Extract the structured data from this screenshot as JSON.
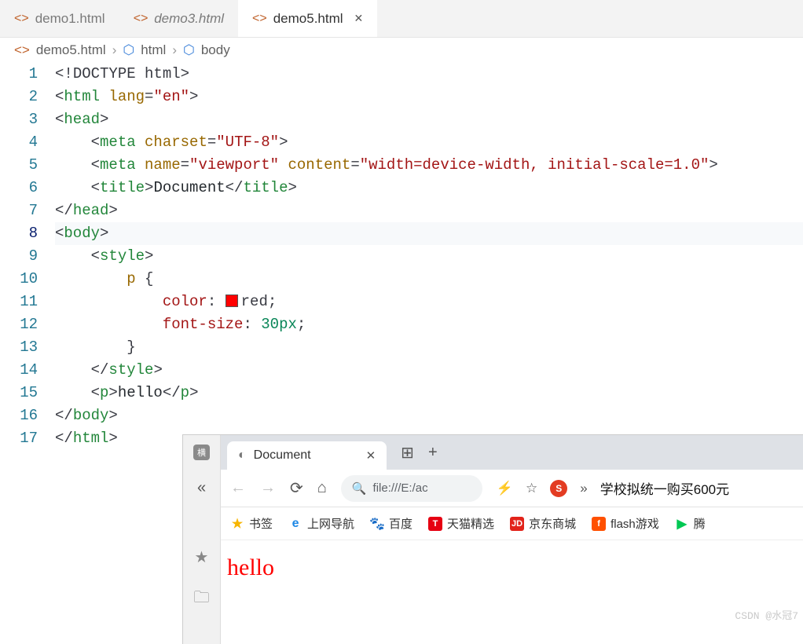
{
  "tabs": [
    {
      "label": "demo1.html",
      "active": false,
      "italic": false
    },
    {
      "label": "demo3.html",
      "active": false,
      "italic": true
    },
    {
      "label": "demo5.html",
      "active": true,
      "italic": false,
      "closable": true
    }
  ],
  "breadcrumbs": {
    "file": "demo5.html",
    "path": [
      "html",
      "body"
    ],
    "separator": "›"
  },
  "code": {
    "lines": [
      {
        "n": 1,
        "seg": [
          [
            "<!",
            "punc"
          ],
          [
            "DOCTYPE html",
            "doctype"
          ],
          [
            ">",
            "punc"
          ]
        ]
      },
      {
        "n": 2,
        "seg": [
          [
            "<",
            "punc"
          ],
          [
            "html",
            "tag"
          ],
          [
            " ",
            ""
          ],
          [
            "lang",
            "attr"
          ],
          [
            "=",
            "punc"
          ],
          [
            "\"en\"",
            "str"
          ],
          [
            ">",
            "punc"
          ]
        ]
      },
      {
        "n": 3,
        "seg": [
          [
            "<",
            "punc"
          ],
          [
            "head",
            "tag"
          ],
          [
            ">",
            "punc"
          ]
        ]
      },
      {
        "n": 4,
        "indent": 1,
        "seg": [
          [
            "<",
            "punc"
          ],
          [
            "meta",
            "tag"
          ],
          [
            " ",
            ""
          ],
          [
            "charset",
            "attr"
          ],
          [
            "=",
            "punc"
          ],
          [
            "\"UTF-8\"",
            "str"
          ],
          [
            ">",
            "punc"
          ]
        ]
      },
      {
        "n": 5,
        "indent": 1,
        "seg": [
          [
            "<",
            "punc"
          ],
          [
            "meta",
            "tag"
          ],
          [
            " ",
            ""
          ],
          [
            "name",
            "attr"
          ],
          [
            "=",
            "punc"
          ],
          [
            "\"viewport\"",
            "str"
          ],
          [
            " ",
            ""
          ],
          [
            "content",
            "attr"
          ],
          [
            "=",
            "punc"
          ],
          [
            "\"width=device-width, initial-scale=1.0\"",
            "str"
          ],
          [
            ">",
            "punc"
          ]
        ]
      },
      {
        "n": 6,
        "indent": 1,
        "seg": [
          [
            "<",
            "punc"
          ],
          [
            "title",
            "tag"
          ],
          [
            ">",
            "punc"
          ],
          [
            "Document",
            "text"
          ],
          [
            "</",
            "punc"
          ],
          [
            "title",
            "tag"
          ],
          [
            ">",
            "punc"
          ]
        ]
      },
      {
        "n": 7,
        "seg": [
          [
            "</",
            "punc"
          ],
          [
            "head",
            "tag"
          ],
          [
            ">",
            "punc"
          ]
        ]
      },
      {
        "n": 8,
        "active": true,
        "seg": [
          [
            "<",
            "punc"
          ],
          [
            "body",
            "tag"
          ],
          [
            ">",
            "punc"
          ]
        ]
      },
      {
        "n": 9,
        "indent": 1,
        "seg": [
          [
            "<",
            "punc"
          ],
          [
            "style",
            "tag"
          ],
          [
            ">",
            "punc"
          ]
        ]
      },
      {
        "n": 10,
        "indent": 2,
        "seg": [
          [
            "p",
            "sel"
          ],
          [
            " {",
            "punc"
          ]
        ]
      },
      {
        "n": 11,
        "indent": 3,
        "swatch": true,
        "seg": [
          [
            "color",
            "prop"
          ],
          [
            ": ",
            "punc"
          ],
          [
            "red",
            "value"
          ],
          [
            ";",
            "punc"
          ]
        ]
      },
      {
        "n": 12,
        "indent": 3,
        "seg": [
          [
            "font-size",
            "prop"
          ],
          [
            ": ",
            "punc"
          ],
          [
            "30px",
            "num"
          ],
          [
            ";",
            "punc"
          ]
        ]
      },
      {
        "n": 13,
        "indent": 2,
        "seg": [
          [
            "}",
            "punc"
          ]
        ]
      },
      {
        "n": 14,
        "indent": 1,
        "seg": [
          [
            "</",
            "punc"
          ],
          [
            "style",
            "tag"
          ],
          [
            ">",
            "punc"
          ]
        ]
      },
      {
        "n": 15,
        "indent": 1,
        "seg": [
          [
            "<",
            "punc"
          ],
          [
            "p",
            "tag"
          ],
          [
            ">",
            "punc"
          ],
          [
            "hello",
            "text"
          ],
          [
            "</",
            "punc"
          ],
          [
            "p",
            "tag"
          ],
          [
            ">",
            "punc"
          ]
        ]
      },
      {
        "n": 16,
        "seg": [
          [
            "</",
            "punc"
          ],
          [
            "body",
            "tag"
          ],
          [
            ">",
            "punc"
          ]
        ]
      },
      {
        "n": 17,
        "seg": [
          [
            "</",
            "punc"
          ],
          [
            "html",
            "tag"
          ],
          [
            ">",
            "punc"
          ]
        ]
      }
    ]
  },
  "browser": {
    "sidebar": {
      "badge": "横",
      "collapse": "«",
      "fav": "★",
      "folder": "🗀"
    },
    "tab": {
      "title": "Document",
      "close": "✕"
    },
    "tabbar": {
      "ext": "⊞",
      "plus": "+"
    },
    "toolbar": {
      "back": "←",
      "forward": "→",
      "reload": "⟳",
      "home": "⌂",
      "search_icon": "🔍",
      "url": "file:///E:/ac",
      "bolt": "⚡",
      "star": "☆",
      "search_badge": "S",
      "arrow": "»",
      "news": "学校拟统一购买600元"
    },
    "bookmarks": [
      {
        "icon": "★",
        "color": "#f7b500",
        "label": "书签"
      },
      {
        "icon": "e",
        "color": "#1e88e5",
        "label": "上网导航"
      },
      {
        "icon": "🐾",
        "color": "#222",
        "label": "百度"
      },
      {
        "icon": "T",
        "bg": "#e60012",
        "label": "天猫精选"
      },
      {
        "icon": "JD",
        "bg": "#e2231a",
        "label": "京东商城"
      },
      {
        "icon": "f",
        "bg": "#ff5000",
        "label": "flash游戏"
      },
      {
        "icon": "▶",
        "color": "#00c853",
        "label": "腾"
      }
    ],
    "page": {
      "hello": "hello"
    }
  },
  "watermark": "CSDN @水冠7"
}
